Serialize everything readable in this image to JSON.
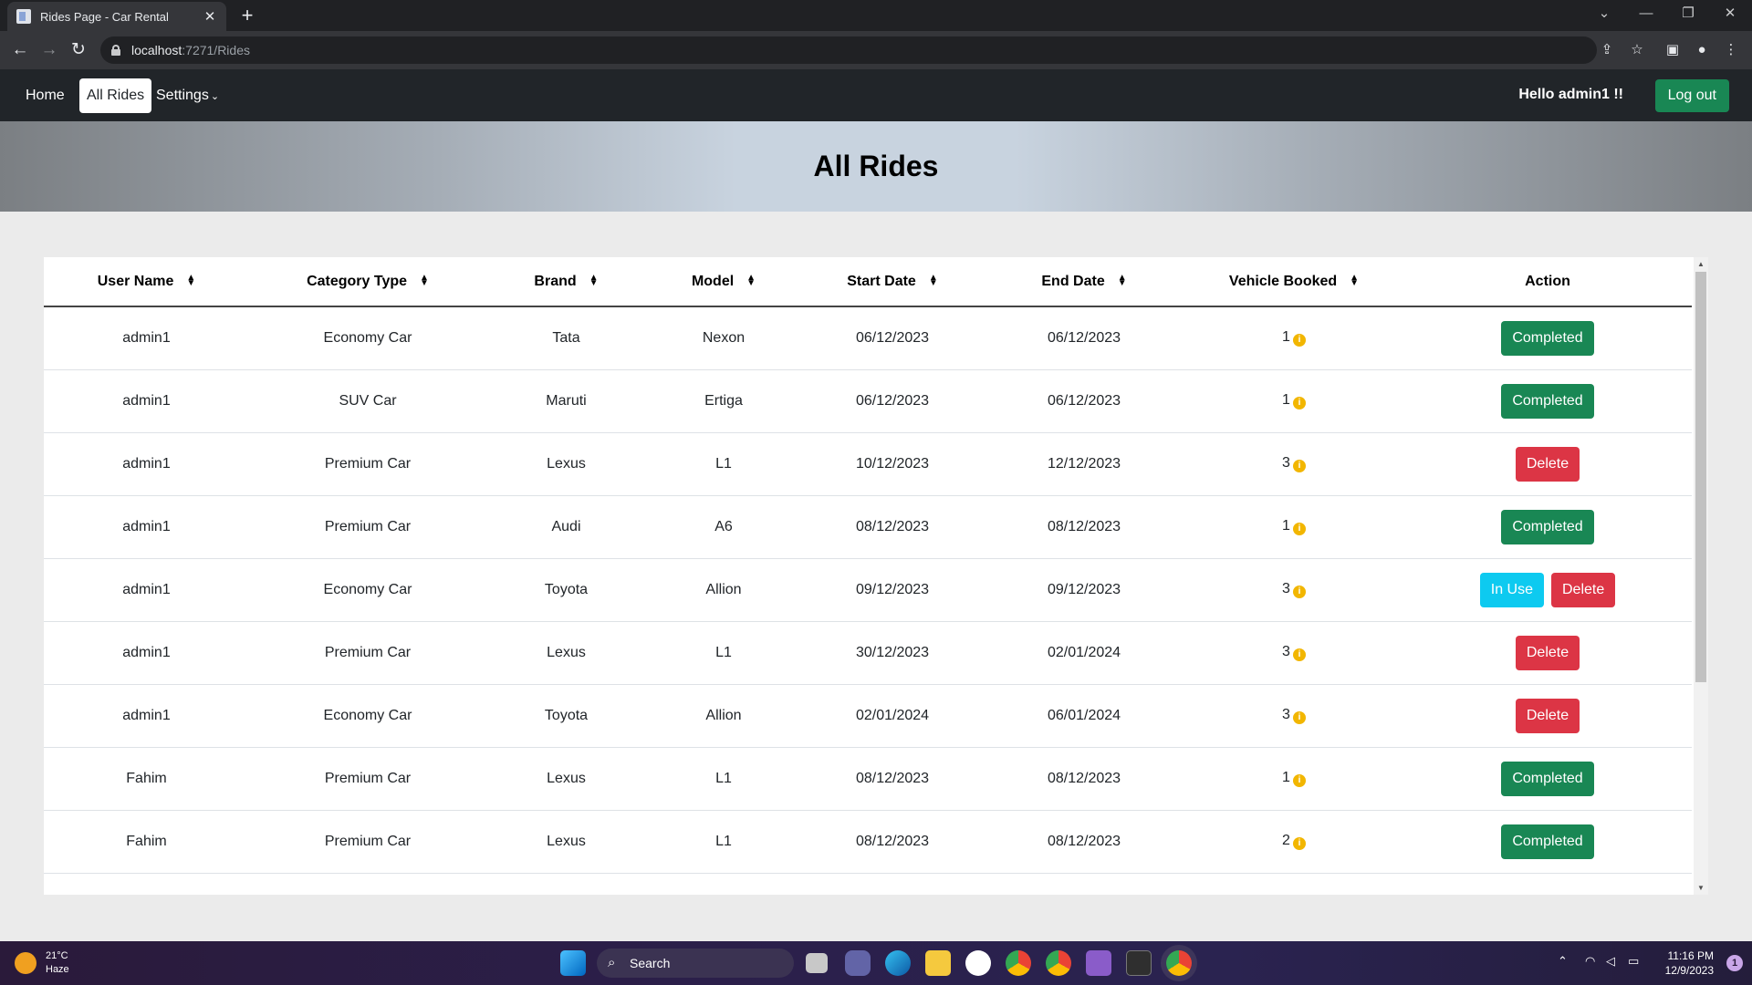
{
  "browser": {
    "tab_title": "Rides Page - Car Rental",
    "tab_close": "✕",
    "new_tab": "+",
    "url_host": "localhost",
    "url_path": ":7271/Rides"
  },
  "navbar": {
    "home": "Home",
    "all_rides": "All Rides",
    "settings": "Settings",
    "greeting": "Hello admin1 !!",
    "logout": "Log out"
  },
  "page": {
    "title": "All Rides"
  },
  "table": {
    "headers": [
      "User Name",
      "Category Type",
      "Brand",
      "Model",
      "Start Date",
      "End Date",
      "Vehicle Booked",
      "Action"
    ],
    "rows": [
      {
        "user": "admin1",
        "category": "Economy Car",
        "brand": "Tata",
        "model": "Nexon",
        "start": "06/12/2023",
        "end": "06/12/2023",
        "booked": "1",
        "actions": [
          "Completed"
        ]
      },
      {
        "user": "admin1",
        "category": "SUV Car",
        "brand": "Maruti",
        "model": "Ertiga",
        "start": "06/12/2023",
        "end": "06/12/2023",
        "booked": "1",
        "actions": [
          "Completed"
        ]
      },
      {
        "user": "admin1",
        "category": "Premium Car",
        "brand": "Lexus",
        "model": "L1",
        "start": "10/12/2023",
        "end": "12/12/2023",
        "booked": "3",
        "actions": [
          "Delete"
        ]
      },
      {
        "user": "admin1",
        "category": "Premium Car",
        "brand": "Audi",
        "model": "A6",
        "start": "08/12/2023",
        "end": "08/12/2023",
        "booked": "1",
        "actions": [
          "Completed"
        ]
      },
      {
        "user": "admin1",
        "category": "Economy Car",
        "brand": "Toyota",
        "model": "Allion",
        "start": "09/12/2023",
        "end": "09/12/2023",
        "booked": "3",
        "actions": [
          "In Use",
          "Delete"
        ]
      },
      {
        "user": "admin1",
        "category": "Premium Car",
        "brand": "Lexus",
        "model": "L1",
        "start": "30/12/2023",
        "end": "02/01/2024",
        "booked": "3",
        "actions": [
          "Delete"
        ]
      },
      {
        "user": "admin1",
        "category": "Economy Car",
        "brand": "Toyota",
        "model": "Allion",
        "start": "02/01/2024",
        "end": "06/01/2024",
        "booked": "3",
        "actions": [
          "Delete"
        ]
      },
      {
        "user": "Fahim",
        "category": "Premium Car",
        "brand": "Lexus",
        "model": "L1",
        "start": "08/12/2023",
        "end": "08/12/2023",
        "booked": "1",
        "actions": [
          "Completed"
        ]
      },
      {
        "user": "Fahim",
        "category": "Premium Car",
        "brand": "Lexus",
        "model": "L1",
        "start": "08/12/2023",
        "end": "08/12/2023",
        "booked": "2",
        "actions": [
          "Completed"
        ]
      }
    ]
  },
  "taskbar": {
    "temperature": "21°C",
    "weather": "Haze",
    "search": "Search",
    "time": "11:16 PM",
    "date": "12/9/2023",
    "notifications": "1"
  },
  "colors": {
    "completed": "#198754",
    "delete": "#dc3545",
    "in_use": "#0dcaf0",
    "navbar": "#212529"
  }
}
